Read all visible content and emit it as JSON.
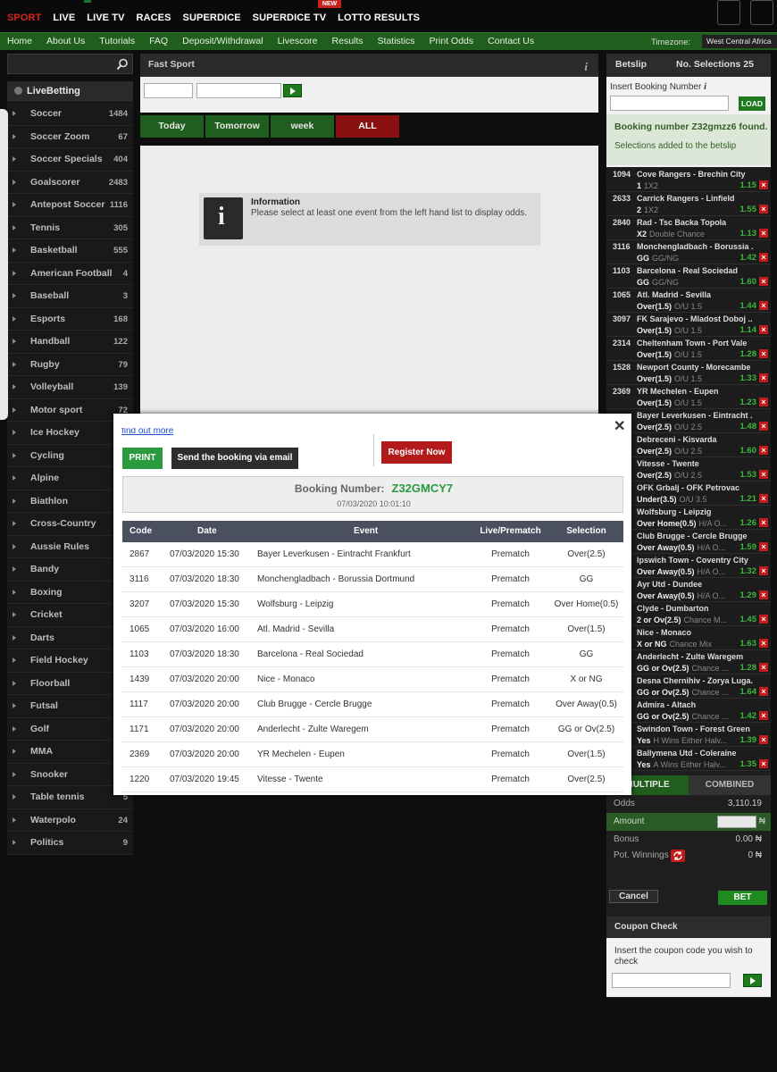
{
  "topnav": {
    "items": [
      "SPORT",
      "LIVE",
      "LIVE TV",
      "RACES",
      "SUPERDICE",
      "SUPERDICE TV",
      "LOTTO RESULTS"
    ],
    "new_badge": "NEW"
  },
  "subnav": {
    "items": [
      "Home",
      "About Us",
      "Tutorials",
      "FAQ",
      "Deposit/Withdrawal",
      "Livescore",
      "Results",
      "Statistics",
      "Print Odds",
      "Contact Us"
    ],
    "timezone_label": "Timezone:",
    "timezone_value": "West Central Africa"
  },
  "sidebar": {
    "live_label": "LiveBetting",
    "sports": [
      {
        "name": "Soccer",
        "count": "1484"
      },
      {
        "name": "Soccer Zoom",
        "count": "67"
      },
      {
        "name": "Soccer Specials",
        "count": "404"
      },
      {
        "name": "Goalscorer",
        "count": "2483"
      },
      {
        "name": "Antepost Soccer",
        "count": "1116"
      },
      {
        "name": "Tennis",
        "count": "305"
      },
      {
        "name": "Basketball",
        "count": "555"
      },
      {
        "name": "American Football",
        "count": "4"
      },
      {
        "name": "Baseball",
        "count": "3"
      },
      {
        "name": "Esports",
        "count": "168"
      },
      {
        "name": "Handball",
        "count": "122"
      },
      {
        "name": "Rugby",
        "count": "79"
      },
      {
        "name": "Volleyball",
        "count": "139"
      },
      {
        "name": "Motor sport",
        "count": "72"
      },
      {
        "name": "Ice Hockey",
        "count": ""
      },
      {
        "name": "Cycling",
        "count": ""
      },
      {
        "name": "Alpine",
        "count": ""
      },
      {
        "name": "Biathlon",
        "count": ""
      },
      {
        "name": "Cross-Country",
        "count": ""
      },
      {
        "name": "Aussie Rules",
        "count": ""
      },
      {
        "name": "Bandy",
        "count": ""
      },
      {
        "name": "Boxing",
        "count": ""
      },
      {
        "name": "Cricket",
        "count": ""
      },
      {
        "name": "Darts",
        "count": ""
      },
      {
        "name": "Field Hockey",
        "count": ""
      },
      {
        "name": "Floorball",
        "count": ""
      },
      {
        "name": "Futsal",
        "count": ""
      },
      {
        "name": "Golf",
        "count": ""
      },
      {
        "name": "MMA",
        "count": ""
      },
      {
        "name": "Snooker",
        "count": ""
      },
      {
        "name": "Table tennis",
        "count": "5"
      },
      {
        "name": "Waterpolo",
        "count": "24"
      },
      {
        "name": "Politics",
        "count": "9"
      }
    ]
  },
  "fast_sport": {
    "title": "Fast Sport",
    "tabs": [
      "Today",
      "Tomorrow",
      "week",
      "ALL"
    ],
    "info_title": "Information",
    "info_text": "Please select at least one event from the left hand list to display odds."
  },
  "betslip": {
    "title": "Betslip",
    "selections_label": "No. Selections 25",
    "booking_label": "Insert Booking Number",
    "load_label": "LOAD",
    "found_msg": "Booking number Z32gmzz6 found.",
    "added_msg": "Selections added to the betslip",
    "bets": [
      {
        "code": "1094",
        "event": "Cove Rangers - Brechin City",
        "sel": "1",
        "market": "1X2",
        "odds": "1.15"
      },
      {
        "code": "2633",
        "event": "Carrick Rangers - Linfield",
        "sel": "2",
        "market": "1X2",
        "odds": "1.55"
      },
      {
        "code": "2840",
        "event": "Rad - Tsc Backa Topola",
        "sel": "X2",
        "market": "Double Chance",
        "odds": "1.13"
      },
      {
        "code": "3116",
        "event": "Monchengladbach - Borussia ...",
        "sel": "GG",
        "market": "GG/NG",
        "odds": "1.42"
      },
      {
        "code": "1103",
        "event": "Barcelona - Real Sociedad",
        "sel": "GG",
        "market": "GG/NG",
        "odds": "1.60"
      },
      {
        "code": "1065",
        "event": "Atl. Madrid - Sevilla",
        "sel": "Over(1.5)",
        "market": "O/U 1.5",
        "odds": "1.44"
      },
      {
        "code": "3097",
        "event": "FK Sarajevo - Mladost Doboj ...",
        "sel": "Over(1.5)",
        "market": "O/U 1.5",
        "odds": "1.14"
      },
      {
        "code": "2314",
        "event": "Cheltenham Town - Port Vale",
        "sel": "Over(1.5)",
        "market": "O/U 1.5",
        "odds": "1.28"
      },
      {
        "code": "1528",
        "event": "Newport County - Morecambe",
        "sel": "Over(1.5)",
        "market": "O/U 1.5",
        "odds": "1.33"
      },
      {
        "code": "2369",
        "event": "YR Mechelen - Eupen",
        "sel": "Over(1.5)",
        "market": "O/U 1.5",
        "odds": "1.23"
      },
      {
        "code": "",
        "event": "Bayer Leverkusen - Eintracht ...",
        "sel": "Over(2.5)",
        "market": "O/U 2.5",
        "odds": "1.48"
      },
      {
        "code": "",
        "event": "Debreceni - Kisvarda",
        "sel": "Over(2.5)",
        "market": "O/U 2.5",
        "odds": "1.60"
      },
      {
        "code": "",
        "event": "Vitesse - Twente",
        "sel": "Over(2.5)",
        "market": "O/U 2.5",
        "odds": "1.53"
      },
      {
        "code": "",
        "event": "OFK Grbalj - OFK Petrovac",
        "sel": "Under(3.5)",
        "market": "O/U 3.5",
        "odds": "1.21"
      },
      {
        "code": "",
        "event": "Wolfsburg - Leipzig",
        "sel": "Over Home(0.5)",
        "market": "H/A O...",
        "odds": "1.26"
      },
      {
        "code": "",
        "event": "Club Brugge - Cercle Brugge",
        "sel": "Over Away(0.5)",
        "market": "H/A O...",
        "odds": "1.59"
      },
      {
        "code": "",
        "event": "Ipswich Town - Coventry City",
        "sel": "Over Away(0.5)",
        "market": "H/A O...",
        "odds": "1.32"
      },
      {
        "code": "",
        "event": "Ayr Utd - Dundee",
        "sel": "Over Away(0.5)",
        "market": "H/A O...",
        "odds": "1.29"
      },
      {
        "code": "",
        "event": "Clyde - Dumbarton",
        "sel": "2 or Ov(2.5)",
        "market": "Chance M...",
        "odds": "1.45"
      },
      {
        "code": "",
        "event": "Nice - Monaco",
        "sel": "X or NG",
        "market": "Chance Mix",
        "odds": "1.63"
      },
      {
        "code": "",
        "event": "Anderlecht - Zulte Waregem",
        "sel": "GG or Ov(2.5)",
        "market": "Chance ...",
        "odds": "1.28"
      },
      {
        "code": "",
        "event": "Desna Chernihiv - Zorya Luga...",
        "sel": "GG or Ov(2.5)",
        "market": "Chance ...",
        "odds": "1.64"
      },
      {
        "code": "",
        "event": "Admira - Altach",
        "sel": "GG or Ov(2.5)",
        "market": "Chance ...",
        "odds": "1.42"
      },
      {
        "code": "",
        "event": "Swindon Town - Forest Green ...",
        "sel": "Yes",
        "market": "H Wins Either Halv...",
        "odds": "1.39"
      },
      {
        "code": "",
        "event": "Ballymena Utd - Coleraine",
        "sel": "Yes",
        "market": "A Wins Either Halv...",
        "odds": "1.35"
      }
    ],
    "tab_multiple": "MULTIPLE",
    "tab_combined": "COMBINED",
    "odds_label": "Odds",
    "odds_value": "3,110.19",
    "amount_label": "Amount",
    "currency": "₦",
    "bonus_label": "Bonus",
    "bonus_value": "0.00 ₦",
    "pot_label": "Pot. Winnings",
    "pot_value": "0 ₦",
    "cancel_label": "Cancel",
    "bet_label": "BET"
  },
  "coupon": {
    "title": "Coupon Check",
    "text": "Insert the coupon code you wish to check"
  },
  "modal": {
    "find_out": "find out more",
    "print_label": "PRINT",
    "email_label": "Send the booking via email",
    "register_label": "Register Now",
    "booking_label": "Booking Number:",
    "booking_number": "Z32GMCY7",
    "booking_date": "07/03/2020 10:01:10",
    "columns": [
      "Code",
      "Date",
      "Event",
      "Live/Prematch",
      "Selection"
    ],
    "rows": [
      {
        "code": "2867",
        "date": "07/03/2020 15:30",
        "event": "Bayer Leverkusen - Eintracht Frankfurt",
        "type": "Prematch",
        "sel": "Over(2.5)"
      },
      {
        "code": "3116",
        "date": "07/03/2020 18:30",
        "event": "Monchengladbach - Borussia Dortmund",
        "type": "Prematch",
        "sel": "GG"
      },
      {
        "code": "3207",
        "date": "07/03/2020 15:30",
        "event": "Wolfsburg - Leipzig",
        "type": "Prematch",
        "sel": "Over Home(0.5)"
      },
      {
        "code": "1065",
        "date": "07/03/2020 16:00",
        "event": "Atl. Madrid - Sevilla",
        "type": "Prematch",
        "sel": "Over(1.5)"
      },
      {
        "code": "1103",
        "date": "07/03/2020 18:30",
        "event": "Barcelona - Real Sociedad",
        "type": "Prematch",
        "sel": "GG"
      },
      {
        "code": "1439",
        "date": "07/03/2020 20:00",
        "event": "Nice - Monaco",
        "type": "Prematch",
        "sel": "X or NG"
      },
      {
        "code": "1117",
        "date": "07/03/2020 20:00",
        "event": "Club Brugge - Cercle Brugge",
        "type": "Prematch",
        "sel": "Over Away(0.5)"
      },
      {
        "code": "1171",
        "date": "07/03/2020 20:00",
        "event": "Anderlecht - Zulte Waregem",
        "type": "Prematch",
        "sel": "GG or Ov(2.5)"
      },
      {
        "code": "2369",
        "date": "07/03/2020 20:00",
        "event": "YR Mechelen - Eupen",
        "type": "Prematch",
        "sel": "Over(1.5)"
      },
      {
        "code": "1220",
        "date": "07/03/2020 19:45",
        "event": "Vitesse - Twente",
        "type": "Prematch",
        "sel": "Over(2.5)"
      }
    ]
  },
  "colors": {
    "brand_green": "#1f5e1c",
    "accent_red": "#d9231d",
    "odds_green": "#3cb63c"
  }
}
